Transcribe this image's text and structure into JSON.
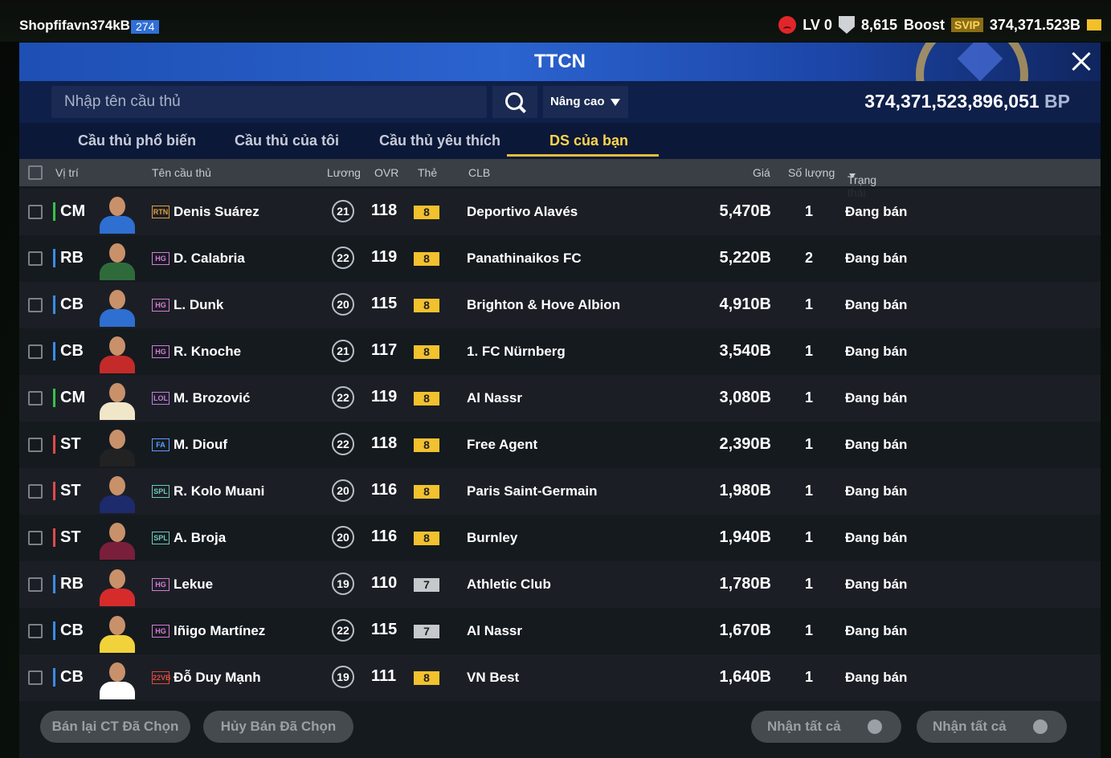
{
  "user": {
    "name": "Shopfifavn374kBp",
    "level": "274"
  },
  "topbar": {
    "lv": "LV 0",
    "tokens": "8,615",
    "boost": "Boost",
    "svip": "SVIP",
    "balance": "374,371.523B"
  },
  "window": {
    "title": "TTCN"
  },
  "search": {
    "placeholder": "Nhập tên cầu thủ",
    "advanced": "Nâng cao"
  },
  "bp": {
    "amount": "374,371,523,896,051",
    "unit": "BP"
  },
  "tabs": [
    "Cầu thủ phổ biến",
    "Cầu thủ của tôi",
    "Cầu thủ yêu thích",
    "DS của bạn"
  ],
  "active_tab": 3,
  "columns": {
    "position": "Vị trí",
    "name": "Tên cầu thủ",
    "salary": "Lương",
    "ovr": "OVR",
    "card": "Thẻ",
    "club": "CLB",
    "price": "Giá",
    "qty": "Số lượng",
    "status": "Trạng thái"
  },
  "rows": [
    {
      "pos": "CM",
      "season": "RTN",
      "name": "Denis Suárez",
      "salary": "21",
      "ovr": "118",
      "card": "8",
      "club": "Deportivo Alavés",
      "price": "5,470B",
      "qty": "1",
      "status": "Đang bán"
    },
    {
      "pos": "RB",
      "season": "HG",
      "name": "D. Calabria",
      "salary": "22",
      "ovr": "119",
      "card": "8",
      "club": "Panathinaikos FC",
      "price": "5,220B",
      "qty": "2",
      "status": "Đang bán"
    },
    {
      "pos": "CB",
      "season": "HG",
      "name": "L. Dunk",
      "salary": "20",
      "ovr": "115",
      "card": "8",
      "club": "Brighton & Hove Albion",
      "price": "4,910B",
      "qty": "1",
      "status": "Đang bán"
    },
    {
      "pos": "CB",
      "season": "HG",
      "name": "R. Knoche",
      "salary": "21",
      "ovr": "117",
      "card": "8",
      "club": "1. FC Nürnberg",
      "price": "3,540B",
      "qty": "1",
      "status": "Đang bán"
    },
    {
      "pos": "CM",
      "season": "LOL",
      "name": "M. Brozović",
      "salary": "22",
      "ovr": "119",
      "card": "8",
      "club": "Al Nassr",
      "price": "3,080B",
      "qty": "1",
      "status": "Đang bán"
    },
    {
      "pos": "ST",
      "season": "FA",
      "name": "M. Diouf",
      "salary": "22",
      "ovr": "118",
      "card": "8",
      "club": "Free Agent",
      "price": "2,390B",
      "qty": "1",
      "status": "Đang bán"
    },
    {
      "pos": "ST",
      "season": "SPL",
      "name": "R. Kolo Muani",
      "salary": "20",
      "ovr": "116",
      "card": "8",
      "club": "Paris Saint-Germain",
      "price": "1,980B",
      "qty": "1",
      "status": "Đang bán"
    },
    {
      "pos": "ST",
      "season": "SPL",
      "name": "A. Broja",
      "salary": "20",
      "ovr": "116",
      "card": "8",
      "club": "Burnley",
      "price": "1,940B",
      "qty": "1",
      "status": "Đang bán"
    },
    {
      "pos": "RB",
      "season": "HG",
      "name": "Lekue",
      "salary": "19",
      "ovr": "110",
      "card": "7",
      "club": "Athletic Club",
      "price": "1,780B",
      "qty": "1",
      "status": "Đang bán"
    },
    {
      "pos": "CB",
      "season": "HG",
      "name": "Iñigo Martínez",
      "salary": "22",
      "ovr": "115",
      "card": "7",
      "club": "Al Nassr",
      "price": "1,670B",
      "qty": "1",
      "status": "Đang bán"
    },
    {
      "pos": "CB",
      "season": "22VB",
      "name": "Đỗ Duy Mạnh",
      "salary": "19",
      "ovr": "111",
      "card": "8",
      "club": "VN Best",
      "price": "1,640B",
      "qty": "1",
      "status": "Đang bán"
    }
  ],
  "colors": {
    "pos": {
      "CM": "#37c24b",
      "RB": "#3a8ce6",
      "CB": "#3a8ce6",
      "ST": "#e14a4a"
    },
    "season": {
      "RTN": "#e2a043",
      "HG": "#d67bd6",
      "LOL": "#c27be0",
      "FA": "#5aa0ff",
      "SPL": "#6ec9b8",
      "22VB": "#e0493c"
    },
    "card": {
      "8": "#f2c12e",
      "7": "#c6c9cc"
    },
    "shirt": [
      "#2e6fd1",
      "#2f6b3a",
      "#2e6fd1",
      "#c42a2a",
      "#f0e6c8",
      "#222222",
      "#1d2a6b",
      "#7a1f3b",
      "#d62b2b",
      "#f2d23a",
      "#ffffff"
    ]
  },
  "footer": {
    "resell": "Bán lại CT Đã Chọn",
    "cancel": "Hủy Bán Đã Chọn",
    "claim_all_1": "Nhận tất cả",
    "claim_all_2": "Nhận tất cả"
  }
}
